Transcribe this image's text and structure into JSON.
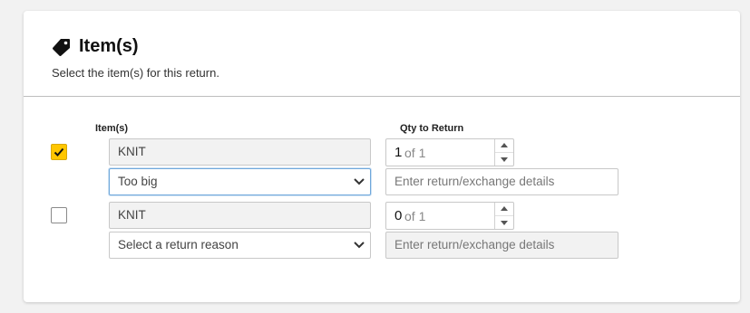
{
  "section": {
    "title": "Item(s)",
    "subtitle": "Select the item(s) for this return."
  },
  "columns": {
    "items": "Item(s)",
    "qty": "Qty to Return"
  },
  "rows": [
    {
      "checked": true,
      "item_name": "KNIT",
      "reason": "Too big",
      "details_placeholder": "Enter return/exchange details",
      "qty_value": "1",
      "qty_of": "of 1"
    },
    {
      "checked": false,
      "item_name": "KNIT",
      "reason": "Select a return reason",
      "details_placeholder": "Enter return/exchange details",
      "qty_value": "0",
      "qty_of": "of 1"
    }
  ],
  "icons": {
    "section": "tag-icon",
    "check": "check-icon",
    "select": "chevron-down-icon",
    "spin_up": "caret-up-icon",
    "spin_down": "caret-down-icon"
  },
  "colors": {
    "accent": "#ffc600",
    "focus_border": "#6fa8dc"
  }
}
